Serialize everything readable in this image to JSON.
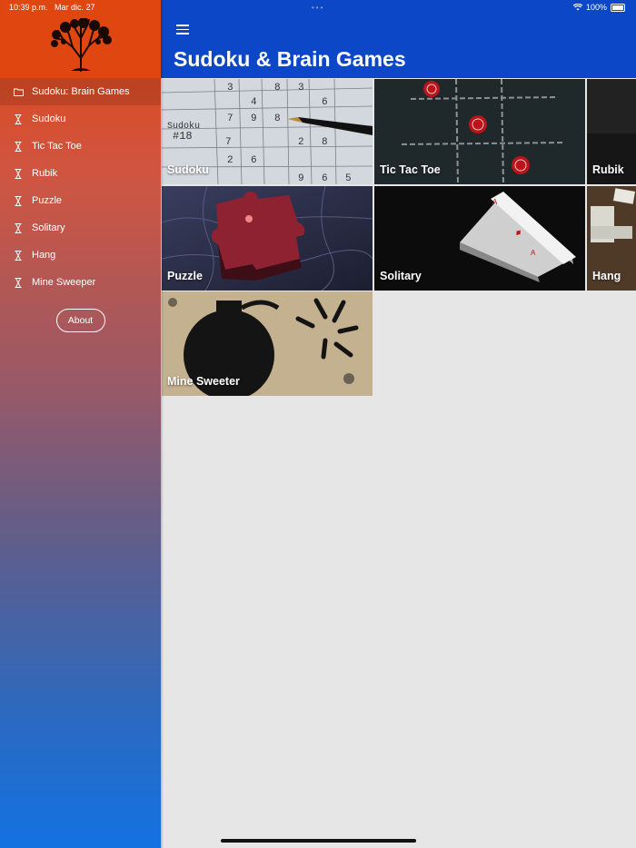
{
  "status_bar": {
    "time": "10:39 p.m.",
    "date": "Mar dic. 27",
    "battery": "100%"
  },
  "header": {
    "title": "Sudoku & Brain Games"
  },
  "sidebar": {
    "items": [
      {
        "label": "Sudoku: Brain Games",
        "icon": "folder-icon",
        "active": true
      },
      {
        "label": "Sudoku",
        "icon": "hourglass-icon"
      },
      {
        "label": "Tic Tac Toe",
        "icon": "hourglass-icon"
      },
      {
        "label": "Rubik",
        "icon": "hourglass-icon"
      },
      {
        "label": "Puzzle",
        "icon": "hourglass-icon"
      },
      {
        "label": "Solitary",
        "icon": "hourglass-icon"
      },
      {
        "label": "Hang",
        "icon": "hourglass-icon"
      },
      {
        "label": "Mine Sweeper",
        "icon": "hourglass-icon"
      }
    ],
    "about_label": "About"
  },
  "tiles": [
    {
      "label": "Sudoku"
    },
    {
      "label": "Tic Tac Toe"
    },
    {
      "label": "Rubik"
    },
    {
      "label": "Puzzle"
    },
    {
      "label": "Solitary"
    },
    {
      "label": "Hang"
    },
    {
      "label": "Mine Sweeter"
    }
  ],
  "colors": {
    "header": "#0c47c8",
    "sidebar_top": "#e04710",
    "sidebar_bottom": "#1372e2",
    "background": "#e6e6e6"
  }
}
